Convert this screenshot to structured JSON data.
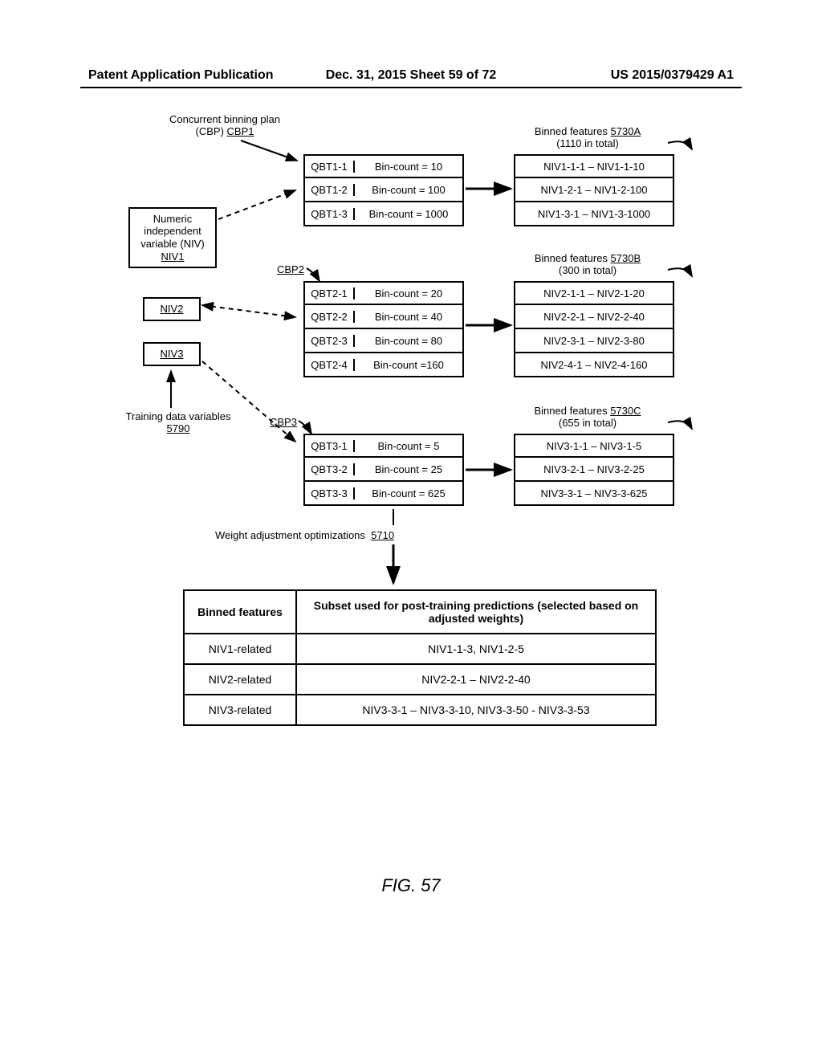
{
  "header": {
    "left": "Patent Application Publication",
    "center": "Dec. 31, 2015   Sheet 59 of 72",
    "right": "US 2015/0379429 A1"
  },
  "labels": {
    "cbp1": "Concurrent binning plan\n(CBP) CBP1",
    "cbp2": "CBP2",
    "cbp3": "CBP3",
    "bf_a": "Binned features 5730A\n(1110 in total)",
    "bf_b": "Binned features 5730B\n(300 in total)",
    "bf_c": "Binned features 5730C\n(655 in total)",
    "niv_box": "Numeric\nindependent\nvariable (NIV)\nNIV1",
    "niv2": "NIV2",
    "niv3": "NIV3",
    "tdv": "Training data variables\n5790",
    "wao": "Weight adjustment optimizations  5710"
  },
  "cbp1_rows": [
    {
      "q": "QBT1-1",
      "c": "Bin-count = 10"
    },
    {
      "q": "QBT1-2",
      "c": "Bin-count = 100"
    },
    {
      "q": "QBT1-3",
      "c": "Bin-count = 1000"
    }
  ],
  "cbp2_rows": [
    {
      "q": "QBT2-1",
      "c": "Bin-count = 20"
    },
    {
      "q": "QBT2-2",
      "c": "Bin-count = 40"
    },
    {
      "q": "QBT2-3",
      "c": "Bin-count = 80"
    },
    {
      "q": "QBT2-4",
      "c": "Bin-count =160"
    }
  ],
  "cbp3_rows": [
    {
      "q": "QBT3-1",
      "c": "Bin-count = 5"
    },
    {
      "q": "QBT3-2",
      "c": "Bin-count = 25"
    },
    {
      "q": "QBT3-3",
      "c": "Bin-count = 625"
    }
  ],
  "bf_a_rows": [
    "NIV1-1-1 – NIV1-1-10",
    "NIV1-2-1 – NIV1-2-100",
    "NIV1-3-1 – NIV1-3-1000"
  ],
  "bf_b_rows": [
    "NIV2-1-1 – NIV2-1-20",
    "NIV2-2-1 – NIV2-2-40",
    "NIV2-3-1 – NIV2-3-80",
    "NIV2-4-1 – NIV2-4-160"
  ],
  "bf_c_rows": [
    "NIV3-1-1 – NIV3-1-5",
    "NIV3-2-1 – NIV3-2-25",
    "NIV3-3-1 – NIV3-3-625"
  ],
  "table": {
    "head": [
      "Binned features",
      "Subset used for post-training predictions (selected based on adjusted weights)"
    ],
    "rows": [
      [
        "NIV1-related",
        "NIV1-1-3, NIV1-2-5"
      ],
      [
        "NIV2-related",
        "NIV2-2-1 – NIV2-2-40"
      ],
      [
        "NIV3-related",
        "NIV3-3-1 – NIV3-3-10, NIV3-3-50 - NIV3-3-53"
      ]
    ]
  },
  "figure": "FIG. 57"
}
